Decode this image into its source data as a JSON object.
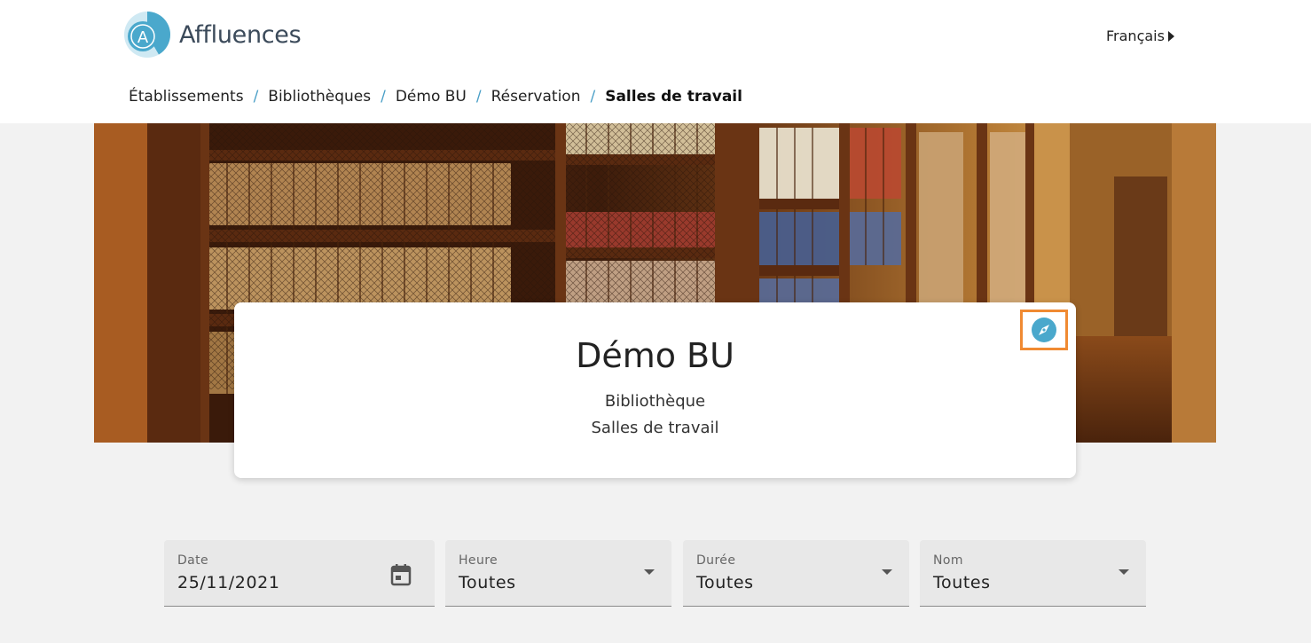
{
  "brand": {
    "name": "Affluences",
    "logo_letter": "A",
    "color": "#4aa8cc"
  },
  "language": {
    "label": "Français"
  },
  "breadcrumb": {
    "items": [
      "Établissements",
      "Bibliothèques",
      "Démo BU",
      "Réservation"
    ],
    "current": "Salles de travail",
    "separator": "/"
  },
  "card": {
    "title": "Démo BU",
    "subtitle1": "Bibliothèque",
    "subtitle2": "Salles de travail",
    "icon": "compass-icon",
    "highlight_color": "#f08a32"
  },
  "filters": {
    "date": {
      "label": "Date",
      "value": "25/11/2021",
      "icon": "calendar-icon"
    },
    "hour": {
      "label": "Heure",
      "value": "Toutes"
    },
    "duration": {
      "label": "Durée",
      "value": "Toutes"
    },
    "name": {
      "label": "Nom",
      "value": "Toutes"
    }
  }
}
